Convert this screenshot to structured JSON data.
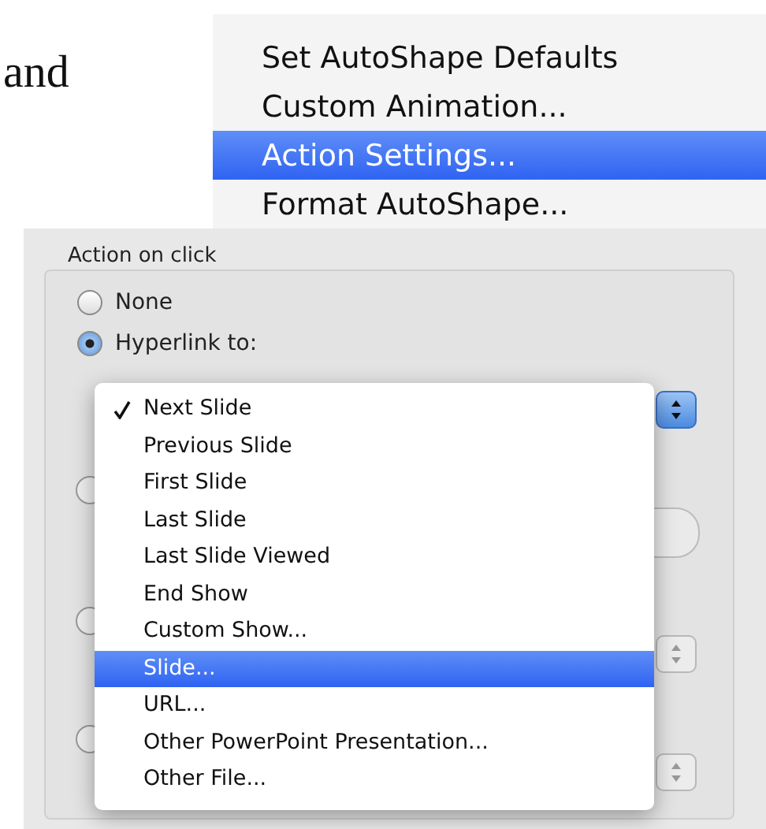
{
  "document_text": [
    "and"
  ],
  "covered_radios": [
    {
      "selected": false
    },
    {
      "selected": false
    },
    {
      "selected": false
    }
  ],
  "context_menu": {
    "items": [
      {
        "label": "Set AutoShape Defaults",
        "selected": false
      },
      {
        "label": "Custom Animation...",
        "selected": false
      },
      {
        "label": "Action Settings...",
        "selected": true
      },
      {
        "label": "Format AutoShape...",
        "selected": false
      }
    ]
  },
  "dialog": {
    "group_label": "Action on click",
    "radios": [
      {
        "label": "None",
        "selected": false
      },
      {
        "label": "Hyperlink to:",
        "selected": true
      }
    ],
    "hyperlink_menu": {
      "items": [
        {
          "label": "Next Slide",
          "checked": true,
          "selected": false
        },
        {
          "label": "Previous Slide",
          "checked": false,
          "selected": false
        },
        {
          "label": "First Slide",
          "checked": false,
          "selected": false
        },
        {
          "label": "Last Slide",
          "checked": false,
          "selected": false
        },
        {
          "label": "Last Slide Viewed",
          "checked": false,
          "selected": false
        },
        {
          "label": "End Show",
          "checked": false,
          "selected": false
        },
        {
          "label": "Custom Show...",
          "checked": false,
          "selected": false
        },
        {
          "label": "Slide...",
          "checked": false,
          "selected": true
        },
        {
          "label": "URL...",
          "checked": false,
          "selected": false
        },
        {
          "label": "Other PowerPoint Presentation...",
          "checked": false,
          "selected": false
        },
        {
          "label": "Other File...",
          "checked": false,
          "selected": false
        }
      ]
    }
  }
}
